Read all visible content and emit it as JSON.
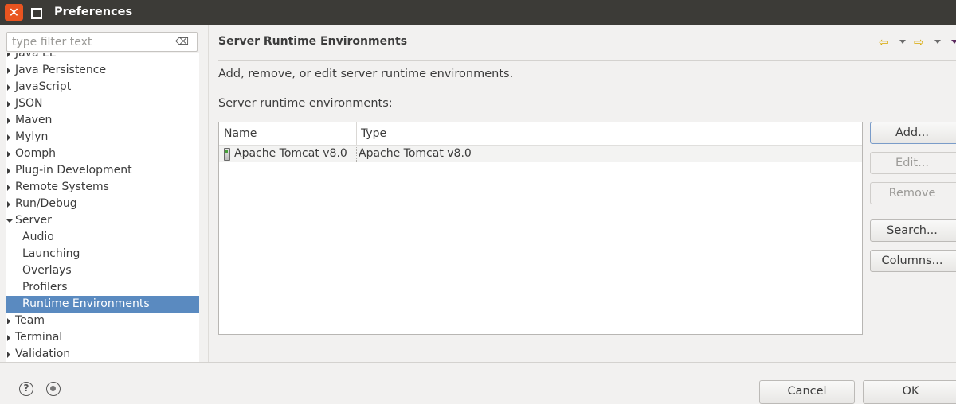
{
  "window": {
    "title": "Preferences"
  },
  "filter": {
    "placeholder": "type filter text",
    "clear_icon": "⌫"
  },
  "tree": {
    "items": [
      {
        "label": "Java EE",
        "expanded": false,
        "child": false,
        "selected": false
      },
      {
        "label": "Java Persistence",
        "expanded": false,
        "child": false,
        "selected": false
      },
      {
        "label": "JavaScript",
        "expanded": false,
        "child": false,
        "selected": false
      },
      {
        "label": "JSON",
        "expanded": false,
        "child": false,
        "selected": false
      },
      {
        "label": "Maven",
        "expanded": false,
        "child": false,
        "selected": false
      },
      {
        "label": "Mylyn",
        "expanded": false,
        "child": false,
        "selected": false
      },
      {
        "label": "Oomph",
        "expanded": false,
        "child": false,
        "selected": false
      },
      {
        "label": "Plug-in Development",
        "expanded": false,
        "child": false,
        "selected": false
      },
      {
        "label": "Remote Systems",
        "expanded": false,
        "child": false,
        "selected": false
      },
      {
        "label": "Run/Debug",
        "expanded": false,
        "child": false,
        "selected": false
      },
      {
        "label": "Server",
        "expanded": true,
        "child": false,
        "selected": false
      },
      {
        "label": "Audio",
        "expanded": false,
        "child": true,
        "selected": false
      },
      {
        "label": "Launching",
        "expanded": false,
        "child": true,
        "selected": false
      },
      {
        "label": "Overlays",
        "expanded": false,
        "child": true,
        "selected": false
      },
      {
        "label": "Profilers",
        "expanded": false,
        "child": true,
        "selected": false
      },
      {
        "label": "Runtime Environments",
        "expanded": false,
        "child": true,
        "selected": true
      },
      {
        "label": "Team",
        "expanded": false,
        "child": false,
        "selected": false
      },
      {
        "label": "Terminal",
        "expanded": false,
        "child": false,
        "selected": false
      },
      {
        "label": "Validation",
        "expanded": false,
        "child": false,
        "selected": false
      }
    ]
  },
  "page": {
    "title": "Server Runtime Environments",
    "description": "Add, remove, or edit server runtime environments.",
    "list_label": "Server runtime environments:"
  },
  "nav": {
    "back_icon": "⇦",
    "forward_icon": "⇨"
  },
  "table": {
    "columns": [
      "Name",
      "Type"
    ],
    "rows": [
      {
        "name": "Apache Tomcat v8.0",
        "type": "Apache Tomcat v8.0"
      }
    ]
  },
  "buttons": {
    "add": "Add...",
    "edit": "Edit...",
    "remove": "Remove",
    "search": "Search...",
    "columns": "Columns..."
  },
  "dialog": {
    "cancel": "Cancel",
    "ok": "OK",
    "help_icon": "?"
  },
  "colors": {
    "titlebar": "#3c3b37",
    "close_button": "#e95420",
    "selection": "#5a8ac0"
  }
}
